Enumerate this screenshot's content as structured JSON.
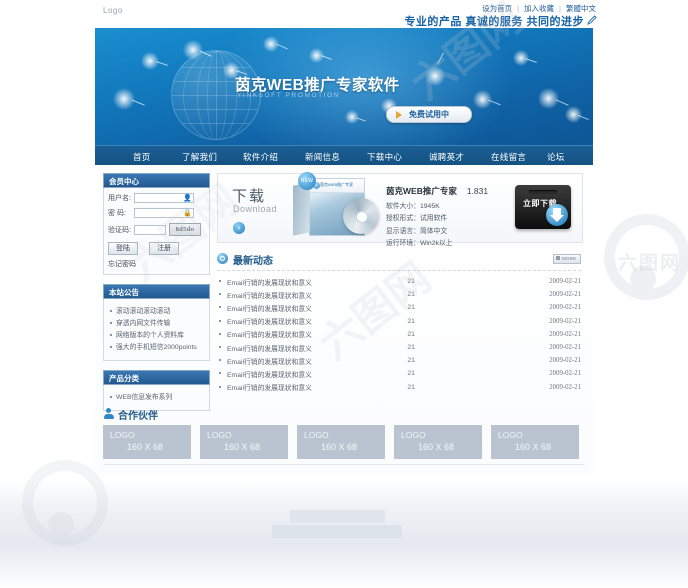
{
  "site": {
    "logo": "Logo",
    "top_links": [
      "设为首页",
      "加入收藏",
      "繁體中文"
    ],
    "separator": "|",
    "tagline": "专业的产品 真诚的服务 共同的进步"
  },
  "banner": {
    "title": "茵克WEB推广专家软件",
    "subtitle": "YINKSOFT PROMOTION",
    "trial_button": "免费试用中"
  },
  "nav": {
    "items": [
      {
        "label": "首页"
      },
      {
        "label": "了解我们"
      },
      {
        "label": "软件介绍"
      },
      {
        "label": "新闻信息"
      },
      {
        "label": "下载中心"
      },
      {
        "label": "诚聘英才"
      },
      {
        "label": "在线留言"
      },
      {
        "label": "论坛"
      }
    ]
  },
  "member": {
    "title": "会员中心",
    "username_label": "用户名:",
    "username_value": "",
    "password_label": "密  码:",
    "password_value": "",
    "captcha_label": "验证码:",
    "captcha_value": "",
    "captcha_text": "8d5do",
    "login_button": "登陆",
    "register_button": "注册",
    "forgot_link": "忘记密码"
  },
  "announcements": {
    "title": "本站公告",
    "items": [
      {
        "label": "滚动滚动滚动滚动"
      },
      {
        "label": "穿透内网文件传输"
      },
      {
        "label": "网络版本的个人资料库"
      },
      {
        "label": "强大的手机短信2000points"
      }
    ]
  },
  "categories": {
    "title": "产品分类",
    "items": [
      {
        "label": "WEB信息发布系列"
      }
    ]
  },
  "download": {
    "word": "下载",
    "word_en": "Download",
    "arrow_icon": "›",
    "new_badge": "NEW",
    "box_title": "茵克WEB推广专家",
    "product_name": "茵克WEB推广专家",
    "version": "1.831",
    "rows": [
      {
        "label": "软件大小：1945K"
      },
      {
        "label": "授权形式：试用软件"
      },
      {
        "label": "显示语言：简体中文"
      },
      {
        "label": "运行环境：Win2k以上"
      }
    ],
    "download_button": "立即下载"
  },
  "news": {
    "title": "最新动态",
    "more_label": "MORE",
    "rows": [
      {
        "title": "Email行销的发展现状和意义",
        "count": "21",
        "date": "2009-02-21"
      },
      {
        "title": "Email行销的发展现状和意义",
        "count": "21",
        "date": "2009-02-21"
      },
      {
        "title": "Email行销的发展现状和意义",
        "count": "21",
        "date": "2009-02-21"
      },
      {
        "title": "Email行销的发展现状和意义",
        "count": "21",
        "date": "2009-02-21"
      },
      {
        "title": "Email行销的发展现状和意义",
        "count": "21",
        "date": "2009-02-21"
      },
      {
        "title": "Email行销的发展现状和意义",
        "count": "21",
        "date": "2009-02-21"
      },
      {
        "title": "Email行销的发展现状和意义",
        "count": "21",
        "date": "2009-02-21"
      },
      {
        "title": "Email行销的发展现状和意义",
        "count": "21",
        "date": "2009-02-21"
      },
      {
        "title": "Email行销的发展现状和意义",
        "count": "21",
        "date": "2009-02-21"
      }
    ]
  },
  "partners": {
    "title": "合作伙伴",
    "logos": [
      {
        "name": "LOGO",
        "size": "160 X 68"
      },
      {
        "name": "LOGO",
        "size": "160 X 68"
      },
      {
        "name": "LOGO",
        "size": "160 X 68"
      },
      {
        "name": "LOGO",
        "size": "160 X 68"
      },
      {
        "name": "LOGO",
        "size": "160 X 68"
      }
    ]
  },
  "watermark": {
    "text": "六图网",
    "diagonal": "六图网"
  },
  "colors": {
    "banner_blue": "#1279bd",
    "nav_blue": "#1b5f96",
    "panel_header": "#22578f",
    "accent_link": "#1c5e9c",
    "section_title": "#225b8c",
    "logo_placeholder": "#b9c4d0"
  }
}
